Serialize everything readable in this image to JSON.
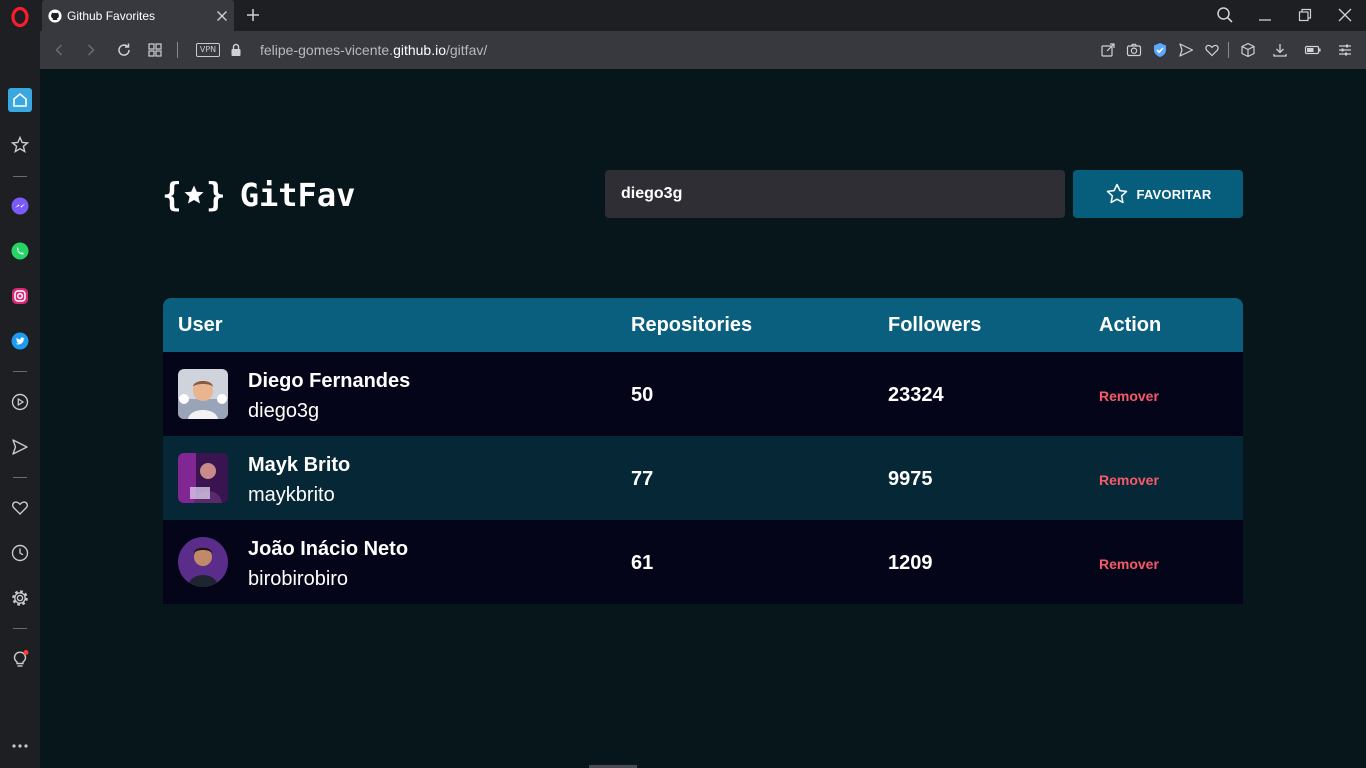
{
  "browser": {
    "tab_title": "Github Favorites",
    "new_tab_label": "+",
    "vpn_label": "VPN",
    "url_prefix": "felipe-gomes-vicente.",
    "url_host": "github.io",
    "url_path": "/gitfav/"
  },
  "sidebar_icons": [
    "opera-logo-icon",
    "home-icon",
    "bookmarks-icon",
    "messenger-icon",
    "whatsapp-icon",
    "instagram-icon",
    "twitter-icon",
    "player-icon",
    "send-icon",
    "heart-icon",
    "history-icon",
    "settings-icon",
    "lightbulb-icon",
    "more-icon"
  ],
  "app": {
    "logo_open_brace": "{",
    "logo_close_brace": "}",
    "logo_name": "GitFav",
    "search_value": "diego3g",
    "favorite_label": "FAVORITAR",
    "columns": {
      "user": "User",
      "repositories": "Repositories",
      "followers": "Followers",
      "action": "Action"
    },
    "users": [
      {
        "name": "Diego Fernandes",
        "login": "diego3g",
        "repositories": "50",
        "followers": "23324",
        "action": "Remover"
      },
      {
        "name": "Mayk Brito",
        "login": "maykbrito",
        "repositories": "77",
        "followers": "9975",
        "action": "Remover"
      },
      {
        "name": "João Inácio Neto",
        "login": "birobirobiro",
        "repositories": "61",
        "followers": "1209",
        "action": "Remover"
      }
    ]
  },
  "colors": {
    "page_bg": "#07161b",
    "accent": "#065e7c",
    "table_header": "#0a5f7e",
    "row_odd": "#050519",
    "row_even": "#062836",
    "remove": "#f75a68",
    "input_bg": "#2f2e34"
  }
}
